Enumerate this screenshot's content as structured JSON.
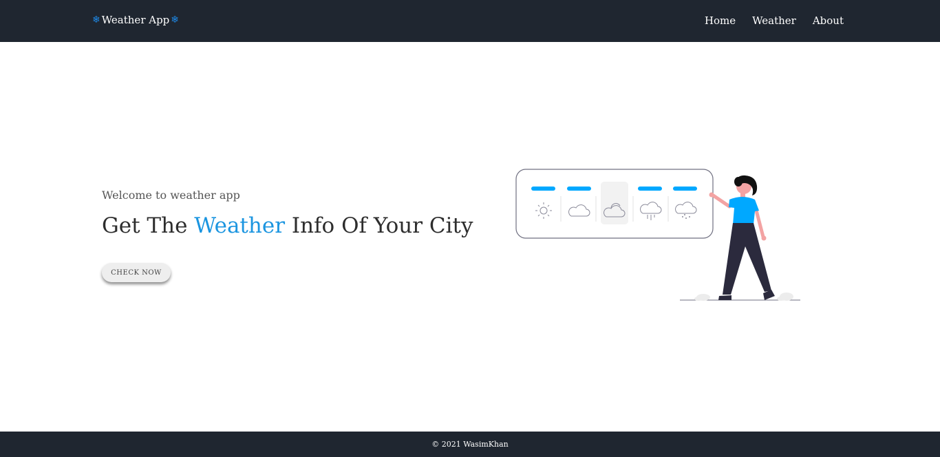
{
  "navbar": {
    "brand": "Weather App",
    "brand_icon": "snowflake-icon",
    "links": [
      "Home",
      "Weather",
      "About"
    ]
  },
  "hero": {
    "welcome": "Welcome to weather app",
    "headline_before": "Get The ",
    "headline_accent": "Weather",
    "headline_after": " Info Of Your City",
    "button_label": "CHECK NOW"
  },
  "illustration": {
    "weather_icons": [
      "sun-icon",
      "cloud-icon",
      "partly-cloudy-icon",
      "rain-icon",
      "snow-icon"
    ],
    "accent_color": "#00a8ff"
  },
  "footer": {
    "copyright": "© 2021 WasimKhan"
  },
  "colors": {
    "nav_bg": "#1f2630",
    "accent": "#1b95e0"
  }
}
